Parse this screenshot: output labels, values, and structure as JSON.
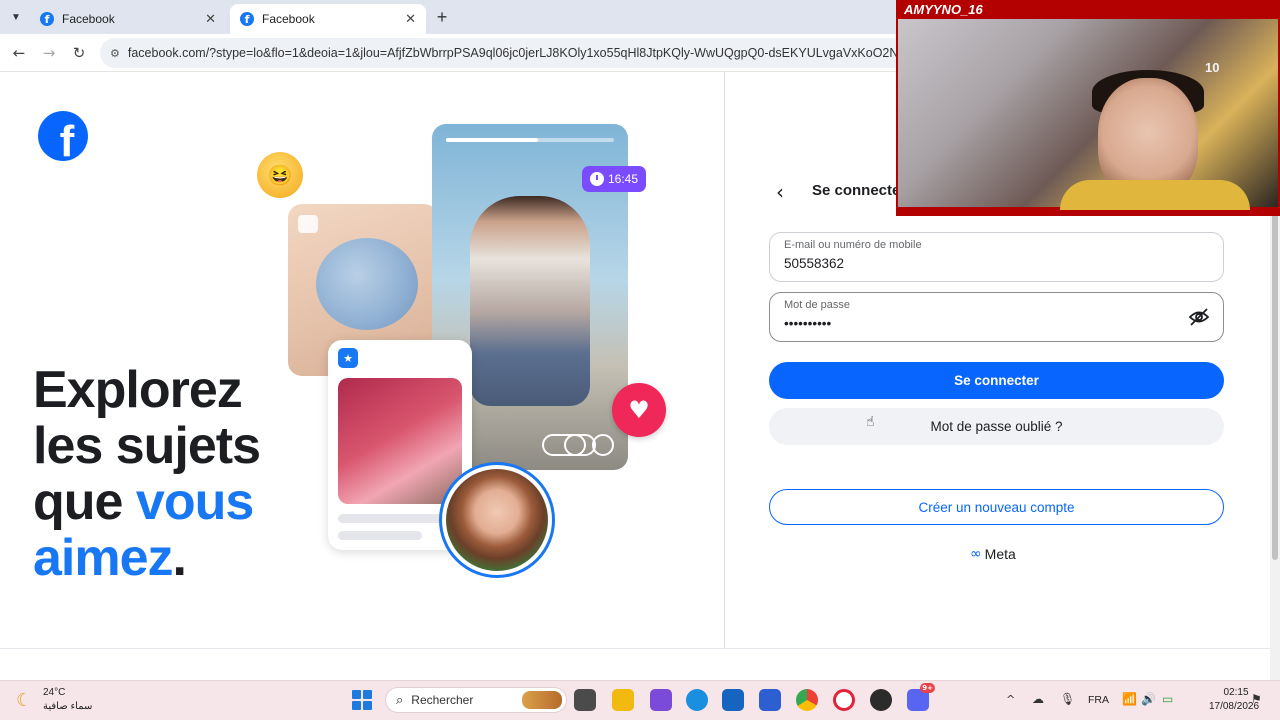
{
  "browser": {
    "tabs": [
      {
        "title": "Facebook",
        "active": false
      },
      {
        "title": "Facebook",
        "active": true
      }
    ],
    "url": "facebook.com/?stype=lo&flo=1&deoia=1&jlou=AfjfZbWbrrpPSA9ql06jc0jerLJ8KOly1xo55qHl8JtpKQly-WwUQgpQ0-dsEKYULvgaVxKoO2NvwEenPre"
  },
  "page": {
    "headline": {
      "line1": "Explorez",
      "line2": "les sujets",
      "line3_dark": "que ",
      "line3_blue": "vous",
      "line4_blue": "aimez",
      "line4_dot": "."
    },
    "collage": {
      "time_badge": "16:45",
      "story_progress": 0.55
    }
  },
  "login": {
    "title": "Se connecte",
    "email_label": "E-mail ou numéro de mobile",
    "email_value": "50558362",
    "password_label": "Mot de passe",
    "password_value": "••••••••••",
    "login_button": "Se connecter",
    "forgot_button": "Mot de passe oublié ?",
    "create_button": "Créer un nouveau compte",
    "brand": "Meta"
  },
  "webcam": {
    "name": "AMYYNO_16",
    "visible_number": "10"
  },
  "taskbar": {
    "weather_temp": "24°C",
    "weather_desc": "سماء صافية",
    "search_placeholder": "Rechercher",
    "language": "FRA",
    "time": "02:15",
    "date": "17/08/2026",
    "discord_badge": "9+"
  },
  "colors": {
    "facebook_blue": "#0866ff",
    "headline_blue": "#1877f2",
    "webcam_frame": "#b30000",
    "taskbar_bg": "#f7e6e9"
  }
}
